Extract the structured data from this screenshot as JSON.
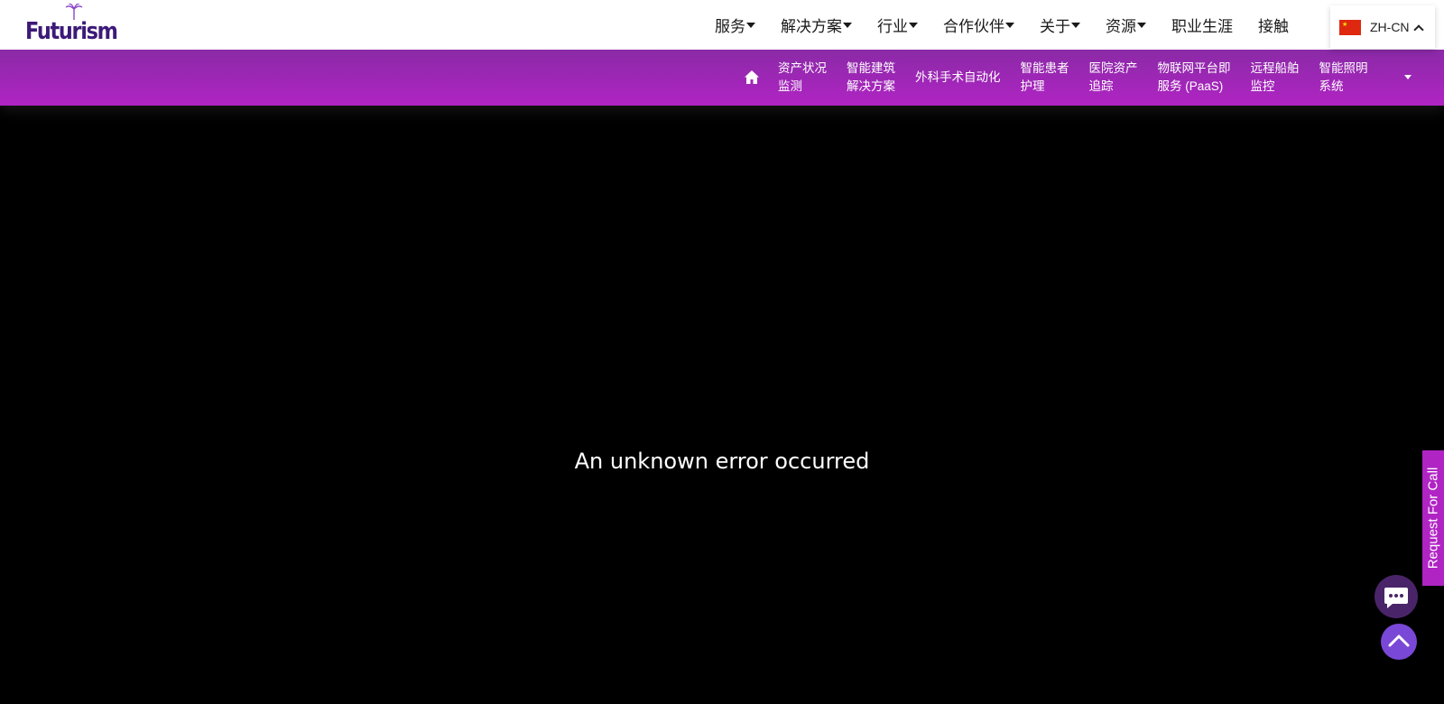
{
  "header": {
    "logo_text": "Futurism",
    "nav": [
      {
        "label": "服务",
        "has_dropdown": true
      },
      {
        "label": "解决方案",
        "has_dropdown": true
      },
      {
        "label": "行业",
        "has_dropdown": true
      },
      {
        "label": "合作伙伴",
        "has_dropdown": true
      },
      {
        "label": "关于",
        "has_dropdown": true
      },
      {
        "label": "资源",
        "has_dropdown": true
      },
      {
        "label": "职业生涯",
        "has_dropdown": false
      },
      {
        "label": "接触",
        "has_dropdown": false
      }
    ],
    "language": {
      "label": "ZH-CN",
      "flag_color": "#de2910"
    }
  },
  "subnav": {
    "home_icon": "home-icon",
    "items": [
      {
        "line1": "资产状况",
        "line2": "监测"
      },
      {
        "line1": "智能建筑",
        "line2": "解决方案"
      },
      {
        "line1": "外科手术自动化",
        "line2": ""
      },
      {
        "line1": "智能患者",
        "line2": "护理"
      },
      {
        "line1": "医院资产",
        "line2": "追踪"
      },
      {
        "line1": "物联网平台即",
        "line2": "服务 (PaaS)"
      },
      {
        "line1": "远程船舶",
        "line2": "监控"
      },
      {
        "line1": "智能照明",
        "line2": "系统"
      }
    ]
  },
  "content": {
    "error_message": "An unknown error occurred"
  },
  "widgets": {
    "request_call_label": "Request For Call",
    "chat_icon": "chat-icon",
    "scroll_top_icon": "chevron-up-icon"
  },
  "colors": {
    "brand_purple": "#3d1a78",
    "subnav_purple": "#b024c4",
    "chat_button": "#4a2468",
    "scroll_top_button": "#7a48d6"
  }
}
